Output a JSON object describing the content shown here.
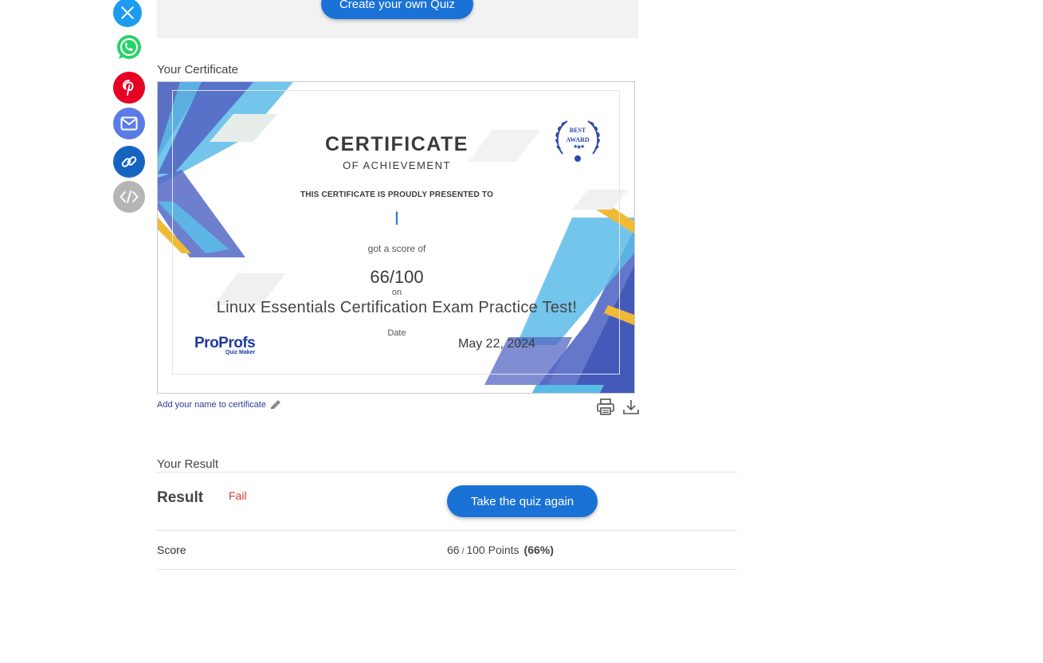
{
  "share_icons": [
    {
      "name": "x-twitter-icon",
      "color": "#1d9bf0"
    },
    {
      "name": "whatsapp-icon",
      "color": "#25d366"
    },
    {
      "name": "pinterest-icon",
      "color": "#e60023"
    },
    {
      "name": "email-icon",
      "color": "#5b7ce6"
    },
    {
      "name": "link-icon",
      "color": "#1565c0"
    },
    {
      "name": "embed-icon",
      "color": "#b5b5b5"
    }
  ],
  "promo": {
    "create_button": "Create your own Quiz"
  },
  "certificate": {
    "section_title": "Your Certificate",
    "title": "CERTIFICATE",
    "subtitle": "OF ACHIEVEMENT",
    "presented": "THIS CERTIFICATE IS PROUDLY PRESENTED TO",
    "name": "I",
    "got_score": "got a score of",
    "score": "66/100",
    "on": "on",
    "quiz_name": "Linux Essentials Certification Exam Practice Test!",
    "date_label": "Date",
    "date": "May 22, 2024",
    "badge_line1": "BEST",
    "badge_line2": "AWARD",
    "logo_main": "ProProfs",
    "logo_sub": "Quiz Maker",
    "add_name_link": "Add your name to certificate"
  },
  "result": {
    "section_title": "Your Result",
    "label": "Result",
    "status": "Fail",
    "retake_button": "Take the quiz again",
    "score_label": "Score",
    "score_points": "66",
    "score_slash": "/",
    "score_total": "100 Points",
    "score_percent": "(66%)"
  },
  "colors": {
    "primary_button": "#1b72d6",
    "fail": "#d23a3a",
    "cert_blue": "#5468c4",
    "cert_light_blue": "#5bbbe8",
    "cert_gold": "#f2b935"
  }
}
